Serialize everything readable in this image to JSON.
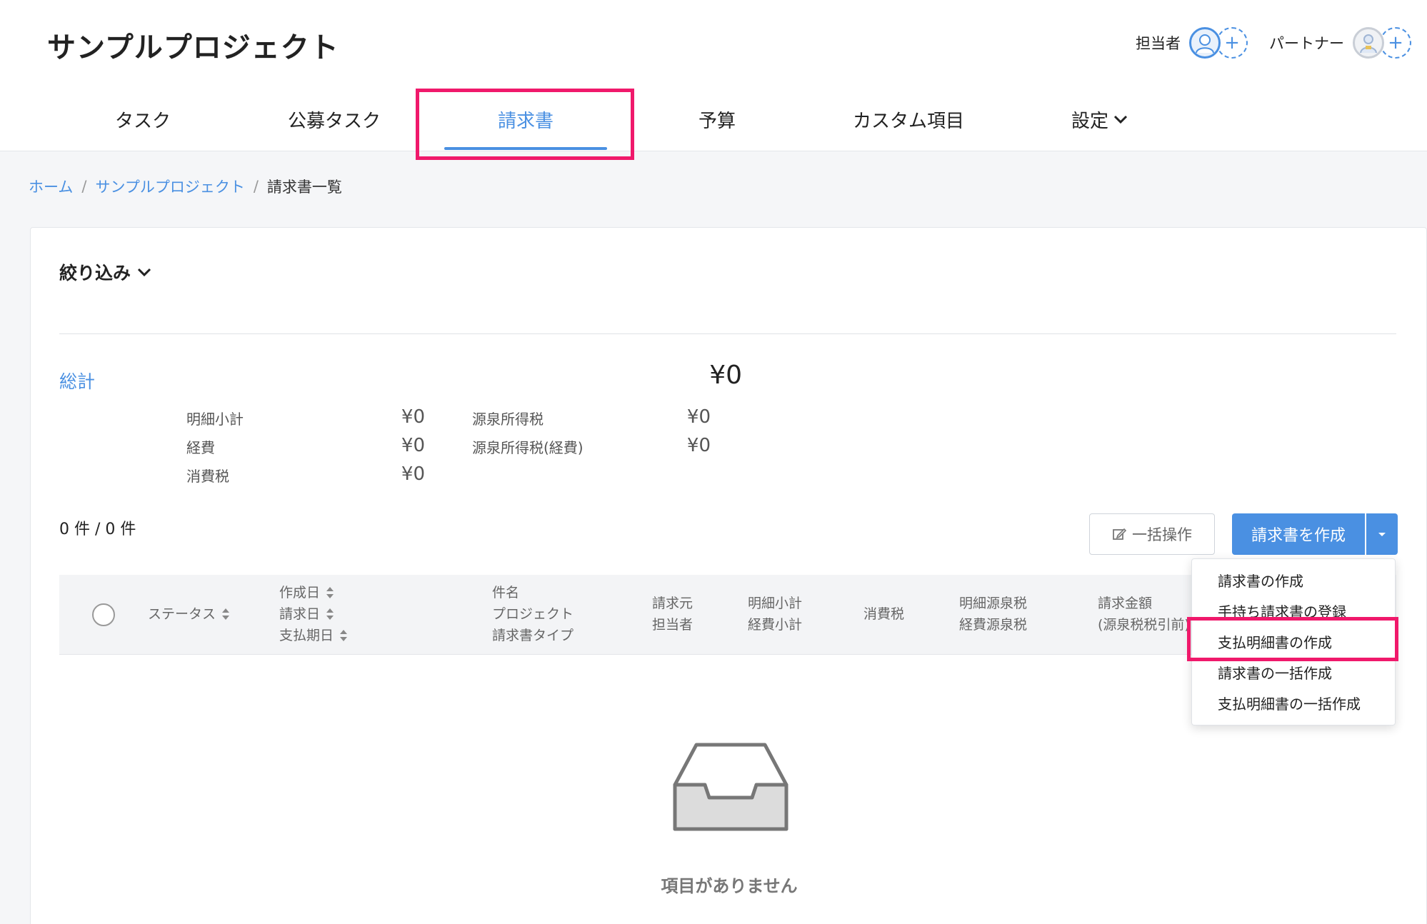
{
  "header": {
    "project_title": "サンプルプロジェクト",
    "assignee_label": "担当者",
    "partner_label": "パートナー",
    "add_symbol": "+"
  },
  "tabs": [
    {
      "label": "タスク",
      "active": false
    },
    {
      "label": "公募タスク",
      "active": false
    },
    {
      "label": "請求書",
      "active": true
    },
    {
      "label": "予算",
      "active": false
    },
    {
      "label": "カスタム項目",
      "active": false
    },
    {
      "label": "設定",
      "active": false,
      "has_dropdown": true
    }
  ],
  "breadcrumb": {
    "home": "ホーム",
    "project": "サンプルプロジェクト",
    "current": "請求書一覧",
    "separator": "/"
  },
  "filter": {
    "label": "絞り込み"
  },
  "summary": {
    "total_label": "総計",
    "total_amount": "¥0",
    "items": [
      {
        "label": "明細小計",
        "value": "¥0"
      },
      {
        "label": "経費",
        "value": "¥0"
      },
      {
        "label": "消費税",
        "value": "¥0"
      },
      {
        "label": "源泉所得税",
        "value": "¥0"
      },
      {
        "label": "源泉所得税(経費)",
        "value": "¥0"
      }
    ]
  },
  "list": {
    "count_text": "0 件 / 0 件",
    "bulk_button": "一括操作",
    "create_button": "請求書を作成"
  },
  "table": {
    "columns": {
      "status": "ステータス",
      "created": "作成日",
      "billed": "請求日",
      "due": "支払期日",
      "subject": "件名",
      "project": "プロジェクト",
      "invoice_type": "請求書タイプ",
      "issuer": "請求元",
      "assignee": "担当者",
      "line_subtotal": "明細小計",
      "expense_subtotal": "経費小計",
      "consumption_tax": "消費税",
      "line_withholding": "明細源泉税",
      "expense_withholding": "経費源泉税",
      "amount": "請求金額",
      "amount_note": "(源泉税税引前)"
    },
    "empty_text": "項目がありません"
  },
  "dropdown": {
    "items": [
      "請求書の作成",
      "手持ち請求書の登録",
      "支払明細書の作成",
      "請求書の一括作成",
      "支払明細書の一括作成"
    ],
    "highlighted_index": 2
  },
  "colors": {
    "accent": "#4a90e2",
    "highlight": "#f0196b"
  }
}
